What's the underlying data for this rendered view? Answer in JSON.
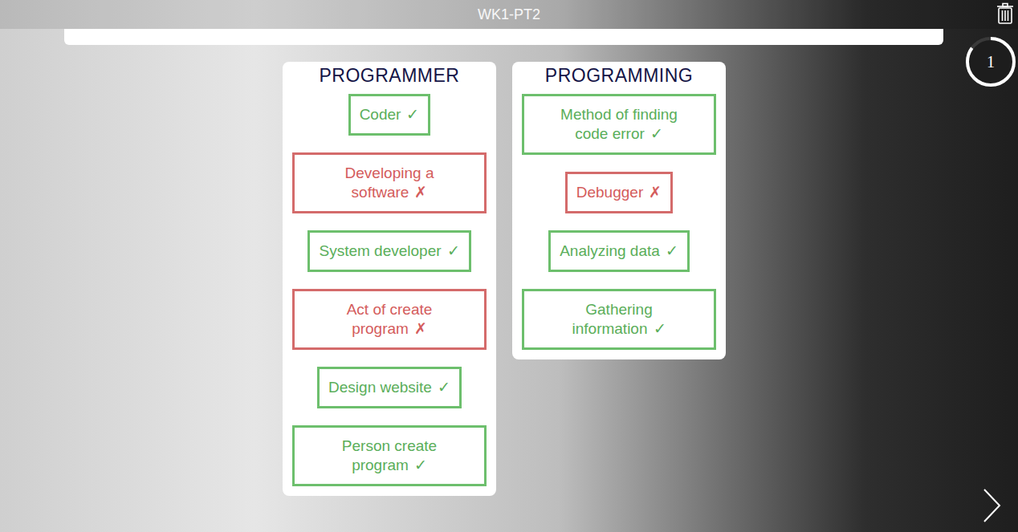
{
  "window": {
    "title": "WK1-PT2"
  },
  "timer": {
    "value": "1",
    "level": 0.85
  },
  "columns": [
    {
      "title": "PROGRAMMER",
      "items": [
        {
          "lines": [
            "Coder"
          ],
          "mark": "✓",
          "correct": true
        },
        {
          "lines": [
            "Developing a",
            "software"
          ],
          "mark": "✗",
          "correct": false
        },
        {
          "lines": [
            "System developer"
          ],
          "mark": "✓",
          "correct": true
        },
        {
          "lines": [
            "Act of create",
            "program"
          ],
          "mark": "✗",
          "correct": false
        },
        {
          "lines": [
            "Design website"
          ],
          "mark": "✓",
          "correct": true
        },
        {
          "lines": [
            "Person create",
            "program"
          ],
          "mark": "✓",
          "correct": true
        }
      ]
    },
    {
      "title": "PROGRAMMING",
      "items": [
        {
          "lines": [
            "Method of finding",
            "code error"
          ],
          "mark": "✓",
          "correct": true
        },
        {
          "lines": [
            "Debugger"
          ],
          "mark": "✗",
          "correct": false
        },
        {
          "lines": [
            "Analyzing data"
          ],
          "mark": "✓",
          "correct": true
        },
        {
          "lines": [
            "Gathering",
            "information"
          ],
          "mark": "✓",
          "correct": true
        }
      ]
    }
  ]
}
